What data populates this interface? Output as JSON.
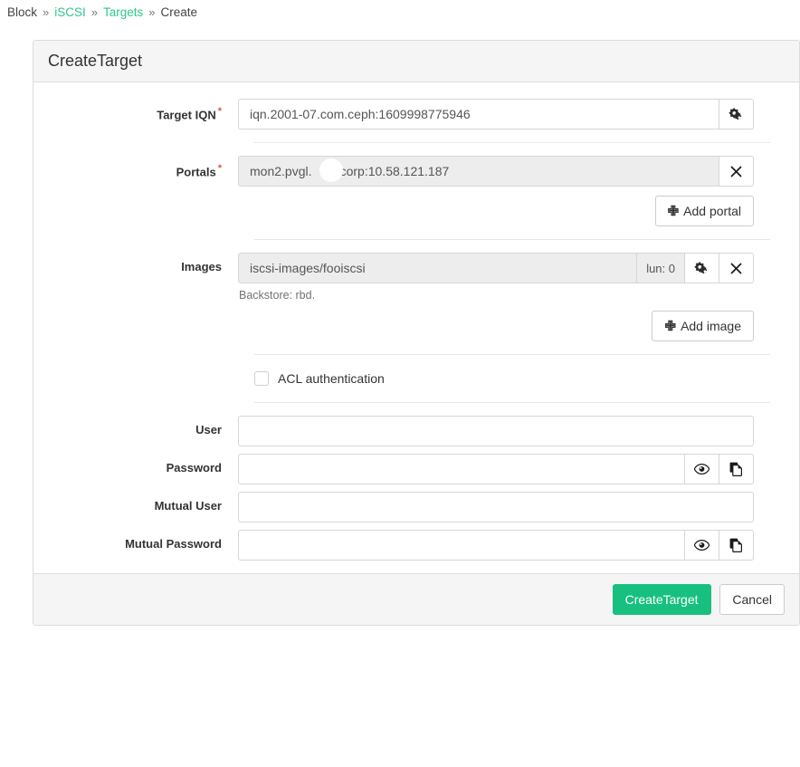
{
  "breadcrumb": {
    "items": [
      {
        "label": "Block",
        "link": false
      },
      {
        "label": "iSCSI",
        "link": true
      },
      {
        "label": "Targets",
        "link": true
      },
      {
        "label": "Create",
        "link": false
      }
    ],
    "separator": "»"
  },
  "panel": {
    "title": "CreateTarget"
  },
  "form": {
    "target_iqn": {
      "label": "Target IQN",
      "required_marker": "*",
      "value": "iqn.2001-07.com.ceph:1609998775946",
      "settings_icon": "gears-icon"
    },
    "portals": {
      "label": "Portals",
      "required_marker": "*",
      "value": "mon2.pvgl.     o.corp:10.58.121.187",
      "remove_icon": "close-x-icon",
      "add_button": "Add portal"
    },
    "images": {
      "label": "Images",
      "value": "iscsi-images/fooiscsi",
      "lun_label": "lun: 0",
      "settings_icon": "gears-icon",
      "remove_icon": "close-x-icon",
      "help": "Backstore: rbd.",
      "add_button": "Add image"
    },
    "acl": {
      "label": "ACL authentication",
      "checked": false
    },
    "user": {
      "label": "User",
      "value": "",
      "placeholder": ""
    },
    "password": {
      "label": "Password",
      "value": "",
      "placeholder": "",
      "toggle_icon": "eye-icon",
      "copy_icon": "copy-icon"
    },
    "mutual_user": {
      "label": "Mutual User",
      "value": "",
      "placeholder": ""
    },
    "mutual_password": {
      "label": "Mutual Password",
      "value": "",
      "placeholder": "",
      "toggle_icon": "eye-icon",
      "copy_icon": "copy-icon"
    }
  },
  "footer": {
    "submit_label": "CreateTarget",
    "cancel_label": "Cancel"
  },
  "colors": {
    "accent_green": "#17c07f",
    "link_green": "#2ec98a",
    "required_red": "#d9534f",
    "panel_header_bg": "#f5f5f5",
    "readonly_bg": "#ededed"
  }
}
